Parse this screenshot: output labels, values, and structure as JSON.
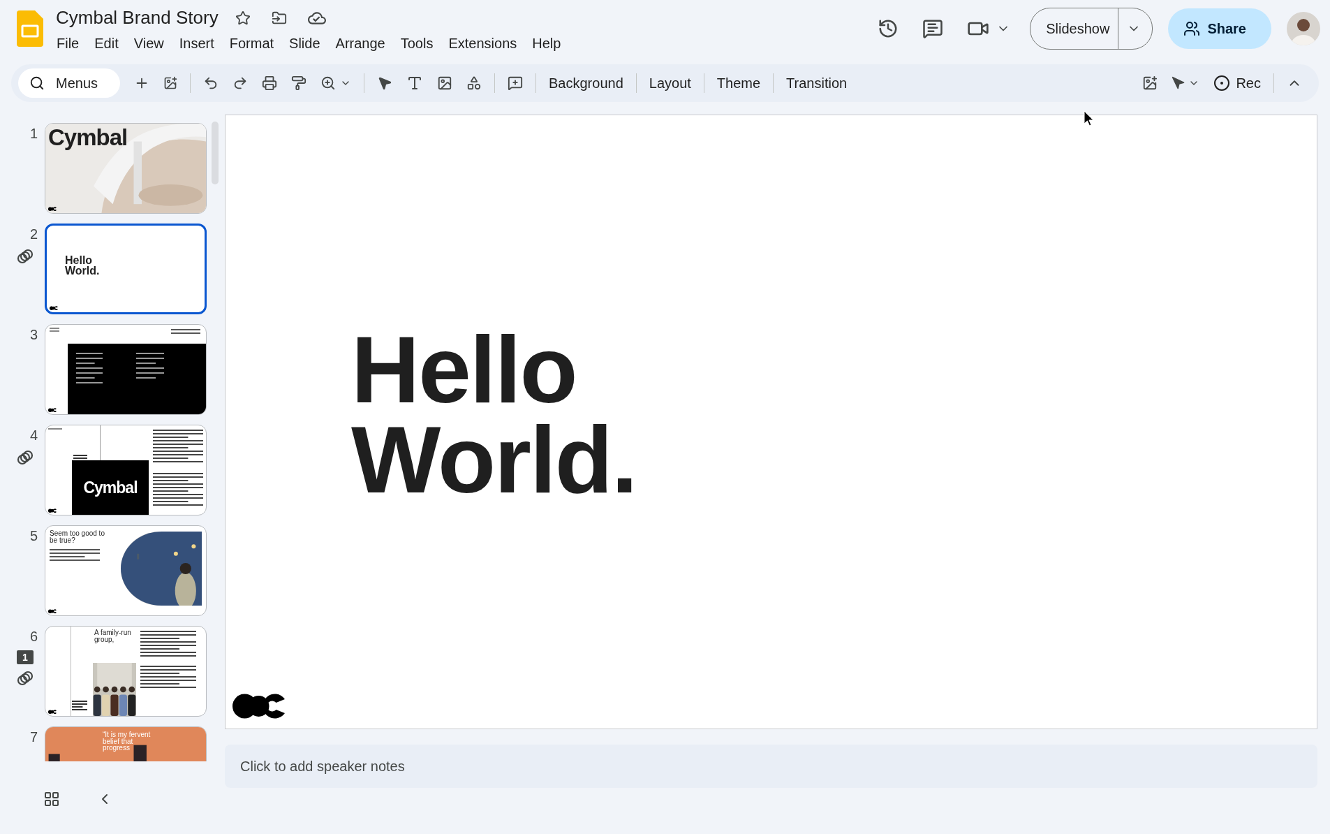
{
  "app": {
    "title": "Cymbal Brand Story",
    "starred": false
  },
  "menu": [
    "File",
    "Edit",
    "View",
    "Insert",
    "Format",
    "Slide",
    "Arrange",
    "Tools",
    "Extensions",
    "Help"
  ],
  "header": {
    "slideshow_label": "Slideshow",
    "share_label": "Share"
  },
  "toolbar": {
    "search_label": "Menus",
    "text_buttons": [
      "Background",
      "Layout",
      "Theme",
      "Transition"
    ],
    "rec_label": "Rec"
  },
  "slides": [
    {
      "number": "1",
      "kind": "cover",
      "selected": false,
      "linked": false,
      "heading": "Cymbal"
    },
    {
      "number": "2",
      "kind": "title",
      "selected": true,
      "linked": true,
      "heading": "Hello World."
    },
    {
      "number": "3",
      "kind": "contents",
      "selected": false,
      "linked": false
    },
    {
      "number": "4",
      "kind": "intro",
      "selected": false,
      "linked": true,
      "heading": "Cymbal"
    },
    {
      "number": "5",
      "kind": "split",
      "selected": false,
      "linked": false,
      "heading": "Seem too good to be true?"
    },
    {
      "number": "6",
      "kind": "family",
      "selected": false,
      "linked": true,
      "comment_count": "1",
      "heading": "A family-run group,"
    },
    {
      "number": "7",
      "kind": "quote",
      "selected": false,
      "linked": false,
      "heading": "“It is my fervent belief that progress"
    }
  ],
  "current_slide": {
    "heading": "Hello World."
  },
  "notes": {
    "placeholder": "Click to add speaker notes"
  }
}
